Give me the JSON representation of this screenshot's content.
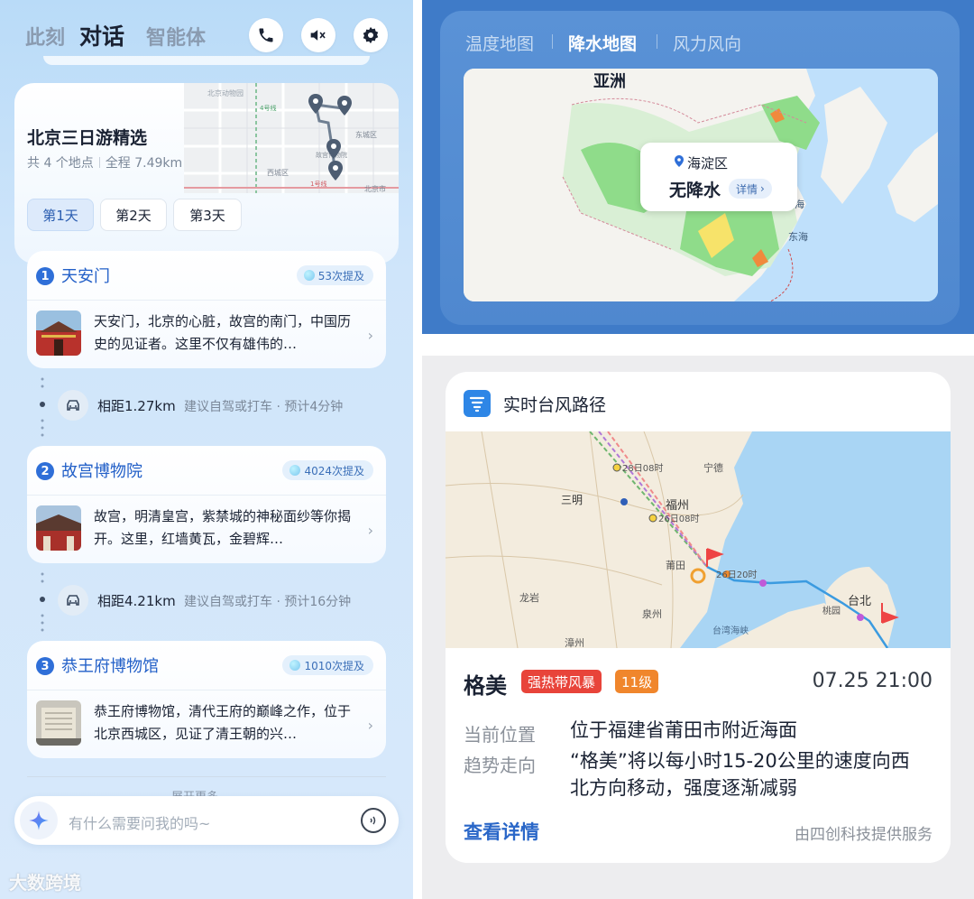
{
  "left": {
    "tabs": [
      "此刻",
      "对话",
      "智能体"
    ],
    "trip": {
      "title": "北京三日游精选",
      "places": "共 4 个地点",
      "distance": "全程 7.49km"
    },
    "days": [
      "第1天",
      "第2天",
      "第3天"
    ],
    "map_labels": [
      "北京动物园",
      "东城区",
      "西城区",
      "故宫博物院",
      "北京市",
      "1号线",
      "4号线"
    ],
    "spots": [
      {
        "num": "1",
        "name": "天安门",
        "mentions": "53次提及",
        "desc": "天安门，北京的心脏，故宫的南门，中国历史的见证者。这里不仅有雄伟的…"
      },
      {
        "num": "2",
        "name": "故宫博物院",
        "mentions": "4024次提及",
        "desc": "故宫，明清皇宫，紫禁城的神秘面纱等你揭开。这里，红墙黄瓦，金碧辉…"
      },
      {
        "num": "3",
        "name": "恭王府博物馆",
        "mentions": "1010次提及",
        "desc": "恭王府博物馆，清代王府的巅峰之作，位于北京西城区，见证了清王朝的兴…"
      }
    ],
    "routes": [
      {
        "dist": "相距1.27km",
        "tip": "建议自驾或打车 · 预计4分钟"
      },
      {
        "dist": "相距4.21km",
        "tip": "建议自驾或打车 · 预计16分钟"
      }
    ],
    "more": "展开更多",
    "input_placeholder": "有什么需要问我的吗~",
    "watermark": "大数跨境"
  },
  "rain": {
    "tabs": [
      "温度地图",
      "降水地图",
      "风力风向"
    ],
    "map_labels": {
      "asia": "亚洲",
      "yellow_sea": "黄海",
      "east_sea": "东海"
    },
    "popup": {
      "location": "海淀区",
      "value": "无降水",
      "detail": "详情"
    }
  },
  "typhoon": {
    "header": "实时台风路径",
    "name": "格美",
    "tag1": "强热带风暴",
    "tag2": "11级",
    "time": "07.25 21:00",
    "position_label": "当前位置",
    "position_value": "位于福建省莆田市附近海面",
    "trend_label": "趋势走向",
    "trend_value": "“格美”将以每小时15-20公里的速度向西北方向移动，强度逐渐减弱",
    "link": "查看详情",
    "source": "由四创科技提供服务",
    "map_labels": {
      "sanming": "三明",
      "fuzhou": "福州",
      "ningde": "宁德",
      "putian": "莆田",
      "longyan": "龙岩",
      "quanzhou": "泉州",
      "zhangzhou": "漳州",
      "taibei": "台北",
      "taoyuan": "桃园",
      "strait": "台湾海峡",
      "t1": "28日08时",
      "t2": "26日08时",
      "t3": "26日20时"
    }
  },
  "colors": {
    "accent": "#2f6fd8",
    "tag_red": "#e8443a",
    "tag_orange": "#f0862c",
    "rain_bg": "#3f7bc8"
  }
}
